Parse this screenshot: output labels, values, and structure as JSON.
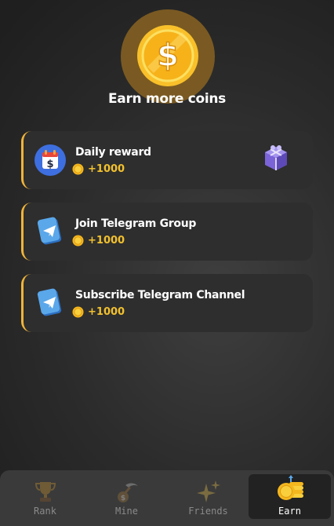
{
  "header": {
    "title": "Earn more coins",
    "icon": "gold-dollar-coin-icon"
  },
  "tasks": [
    {
      "label": "Daily reward",
      "reward": "+1000",
      "icon": "calendar-dollar-icon",
      "extra_icon": "gift-box-icon"
    },
    {
      "label": "Join Telegram Group",
      "reward": "+1000",
      "icon": "telegram-icon"
    },
    {
      "label": "Subscribe Telegram Channel",
      "reward": "+1000",
      "icon": "telegram-icon"
    }
  ],
  "nav": {
    "items": [
      {
        "label": "Rank",
        "icon": "trophy-icon"
      },
      {
        "label": "Mine",
        "icon": "pickaxe-icon"
      },
      {
        "label": "Friends",
        "icon": "sparkles-icon"
      },
      {
        "label": "Earn",
        "icon": "coin-stack-icon"
      }
    ],
    "active": "Earn"
  },
  "colors": {
    "accent": "#f0b43a",
    "reward": "#f2c12e",
    "card": "#2e2e2e",
    "nav": "#3a3a3a"
  }
}
